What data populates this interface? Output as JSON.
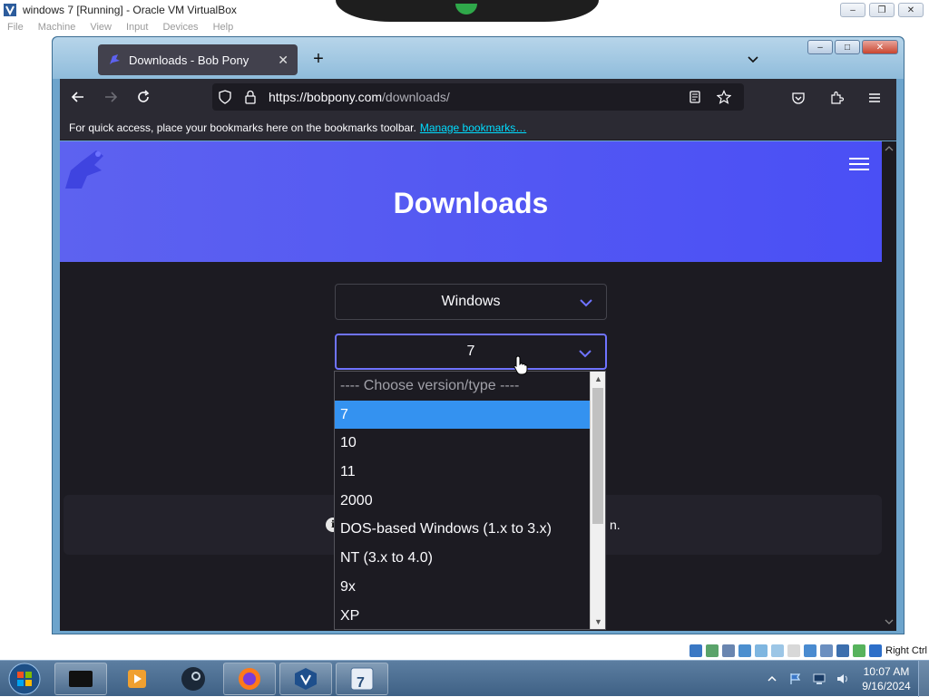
{
  "vbox": {
    "title": "windows 7 [Running] - Oracle VM VirtualBox",
    "menu": [
      "File",
      "Machine",
      "View",
      "Input",
      "Devices",
      "Help"
    ],
    "status_host_key": "Right Ctrl"
  },
  "browser": {
    "tab_title": "Downloads - Bob Pony",
    "new_tab_symbol": "+",
    "url_domain": "https://bobpony.com",
    "url_path": "/downloads/",
    "bookmarks_hint": "For quick access, place your bookmarks here on the bookmarks toolbar.",
    "bookmarks_link": "Manage bookmarks…"
  },
  "page": {
    "heading": "Downloads",
    "os_select_value": "Windows",
    "version_select_value": "7",
    "info_tail": "n.",
    "dropdown_options": [
      "---- Choose version/type ----",
      "7",
      "10",
      "11",
      "2000",
      "DOS-based Windows (1.x to 3.x)",
      "NT (3.x to 4.0)",
      "9x",
      "XP"
    ],
    "dropdown_selected_index": 1
  },
  "taskbar": {
    "time": "10:07 AM",
    "date": "9/16/2024",
    "items": [
      "media-app-icon",
      "media-player-icon",
      "steam-icon",
      "firefox-icon",
      "virtualbox-icon",
      "windows7-vm-icon"
    ]
  },
  "colors": {
    "accent": "#4a4ff5",
    "dropdown_highlight": "#3492f0",
    "page_bg": "#1c1b22"
  }
}
